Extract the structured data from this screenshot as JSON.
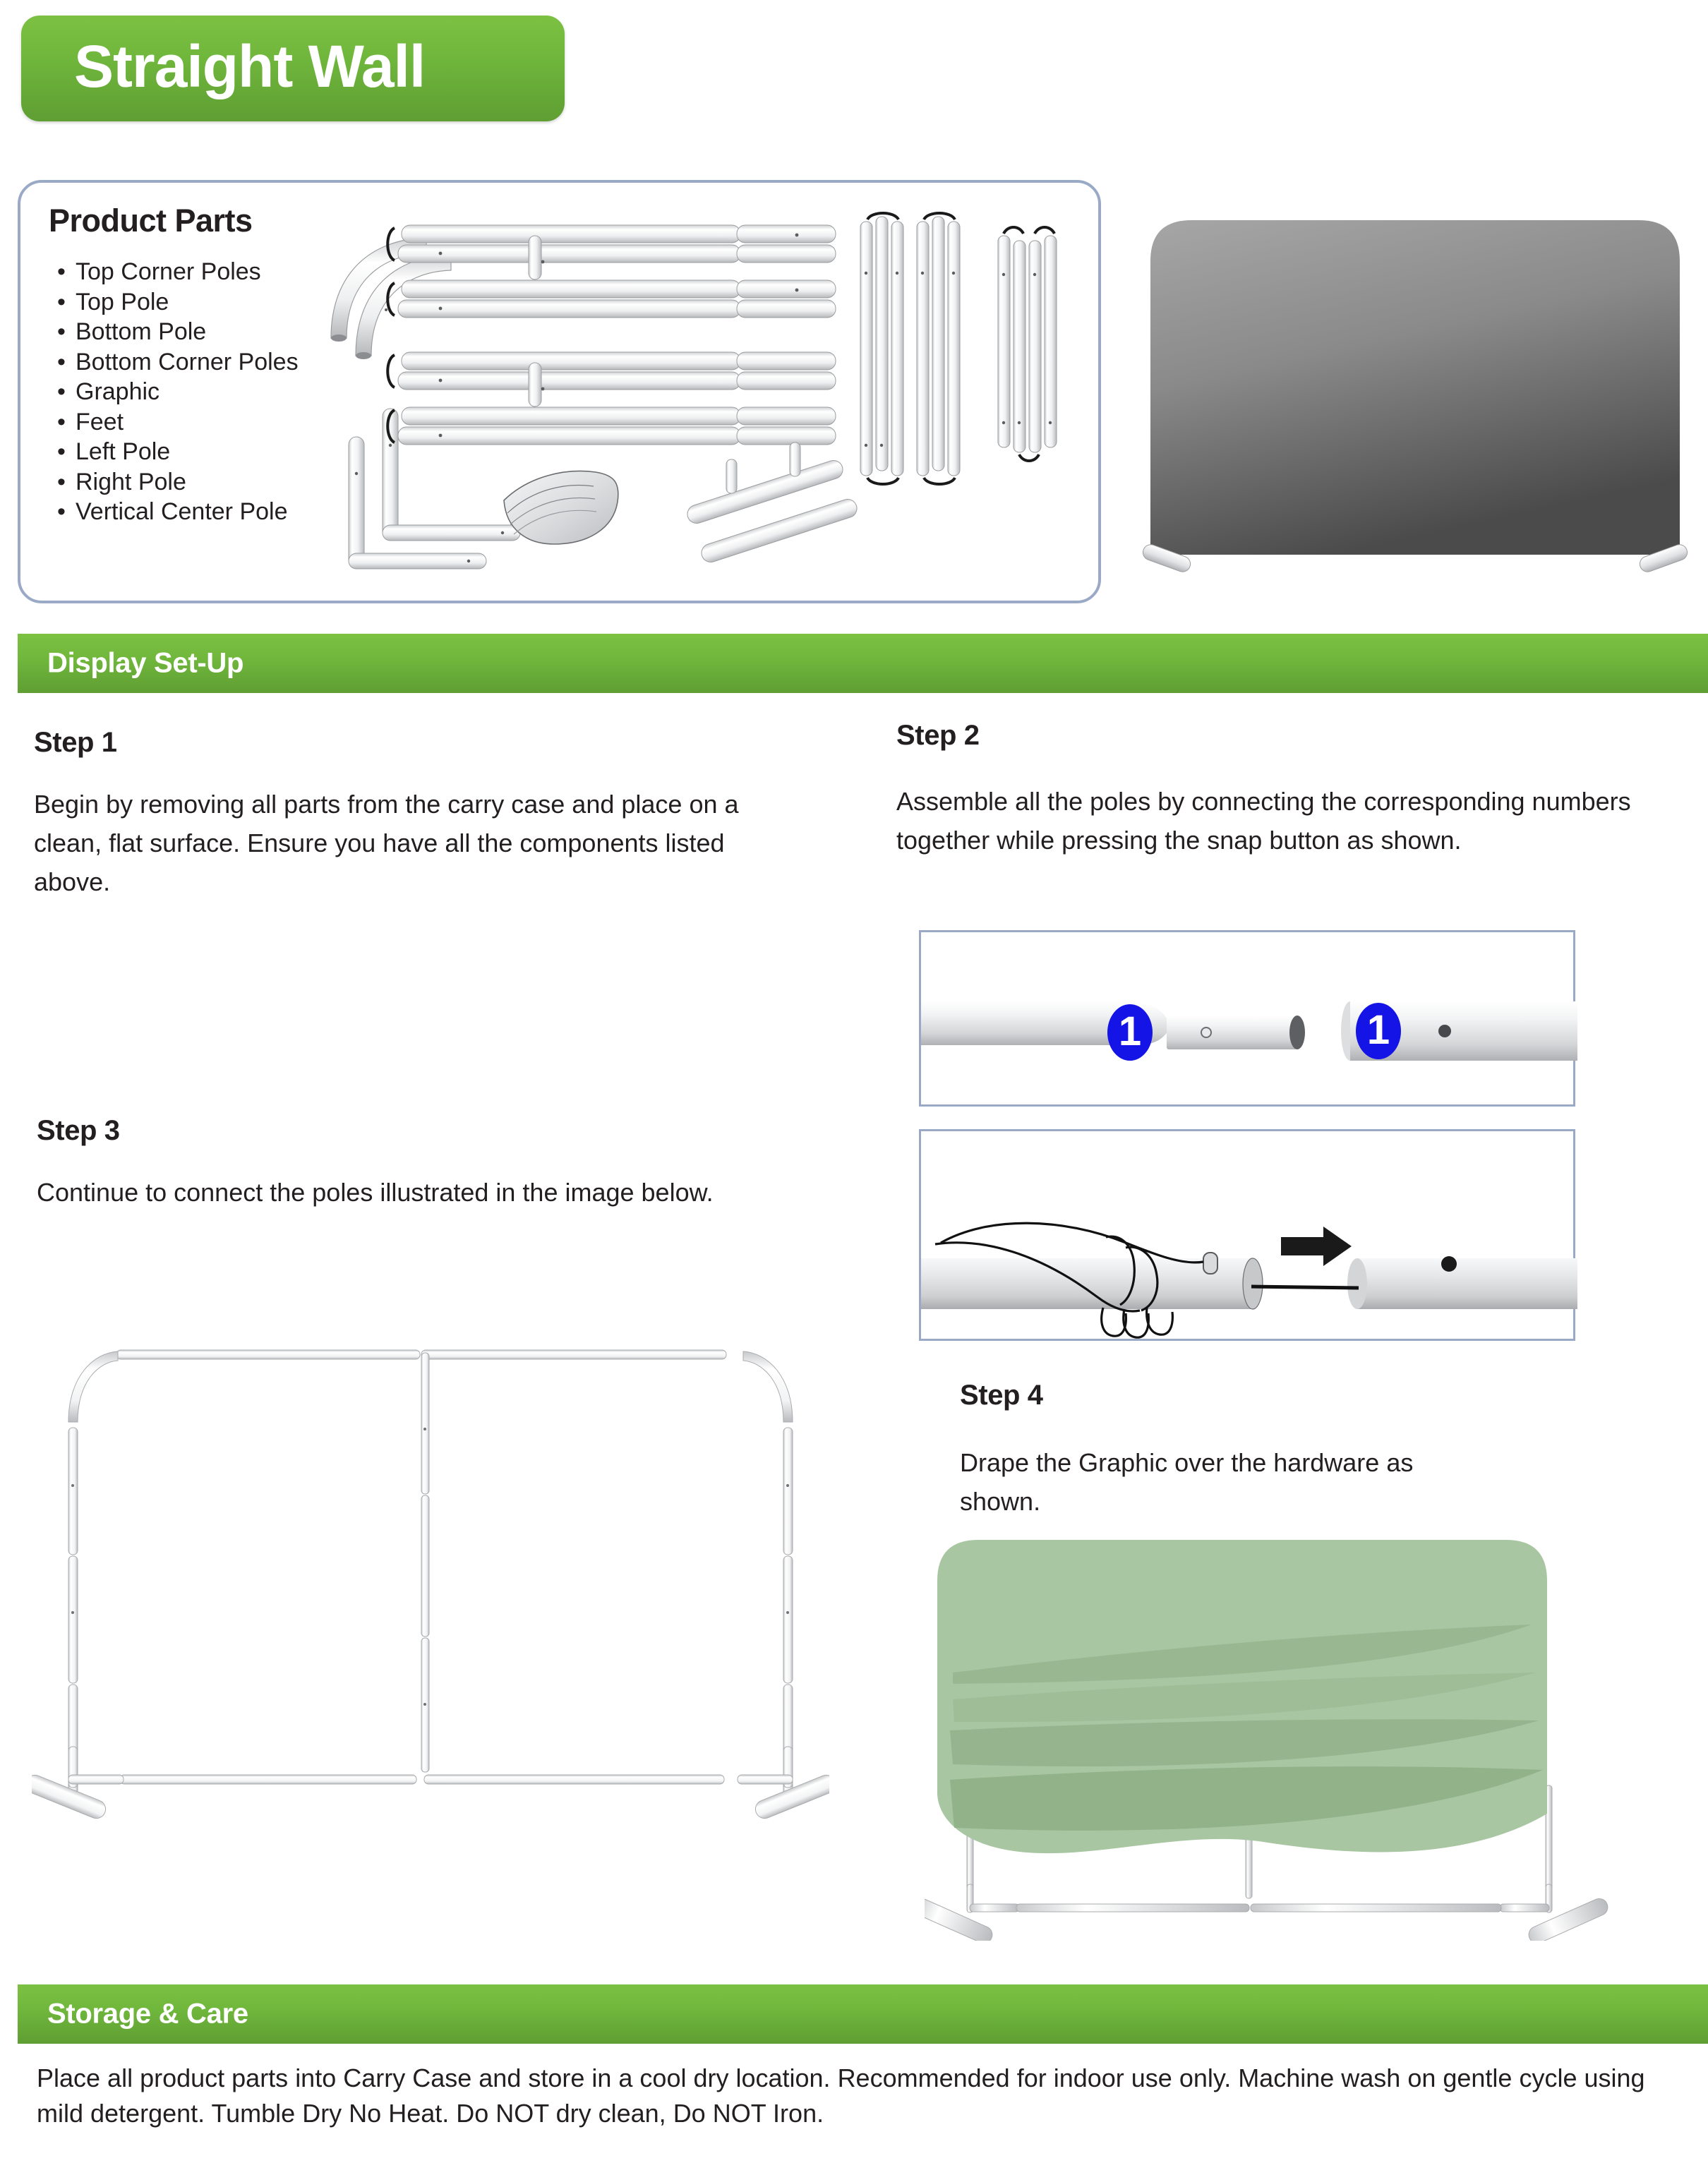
{
  "title": {
    "text": "Straight Wall"
  },
  "colors": {
    "green_light": "#7cc142",
    "green_dark": "#5f9e33",
    "panel_border": "#9aa9c6",
    "badge_blue": "#1414e6",
    "graphic_green": "#a9c6a2",
    "preview_gray_top": "#a3a3a3",
    "preview_gray_bottom": "#4f4f4f",
    "text": "#231f20"
  },
  "parts_panel": {
    "heading": "Product Parts",
    "items": [
      "Top Corner Poles",
      "Top Pole",
      "Bottom Pole",
      "Bottom Corner Poles",
      "Graphic",
      "Feet",
      "Left Pole",
      "Right Pole",
      "Vertical Center Pole"
    ]
  },
  "sections": {
    "setup": {
      "label": "Display Set-Up"
    },
    "storage": {
      "label": "Storage & Care",
      "body": "Place all product parts into Carry Case and store in a cool dry location. Recommended for indoor use only. Machine wash on gentle cycle using mild detergent. Tumble Dry No Heat. Do NOT dry clean, Do NOT Iron."
    }
  },
  "steps": [
    {
      "heading": "Step 1",
      "body": "Begin by removing all parts from the carry case and place on a clean, flat surface. Ensure you have all the components listed above."
    },
    {
      "heading": "Step 2",
      "body": "Assemble all the poles by connecting the corresponding numbers together while pressing the snap button as shown."
    },
    {
      "heading": "Step 3",
      "body": "Continue to connect the poles illustrated in the image below."
    },
    {
      "heading": "Step 4",
      "body": "Drape the Graphic  over the hardware as shown."
    }
  ],
  "diagrams": {
    "snap_connect": {
      "badge_left": "1",
      "badge_right": "1"
    }
  }
}
